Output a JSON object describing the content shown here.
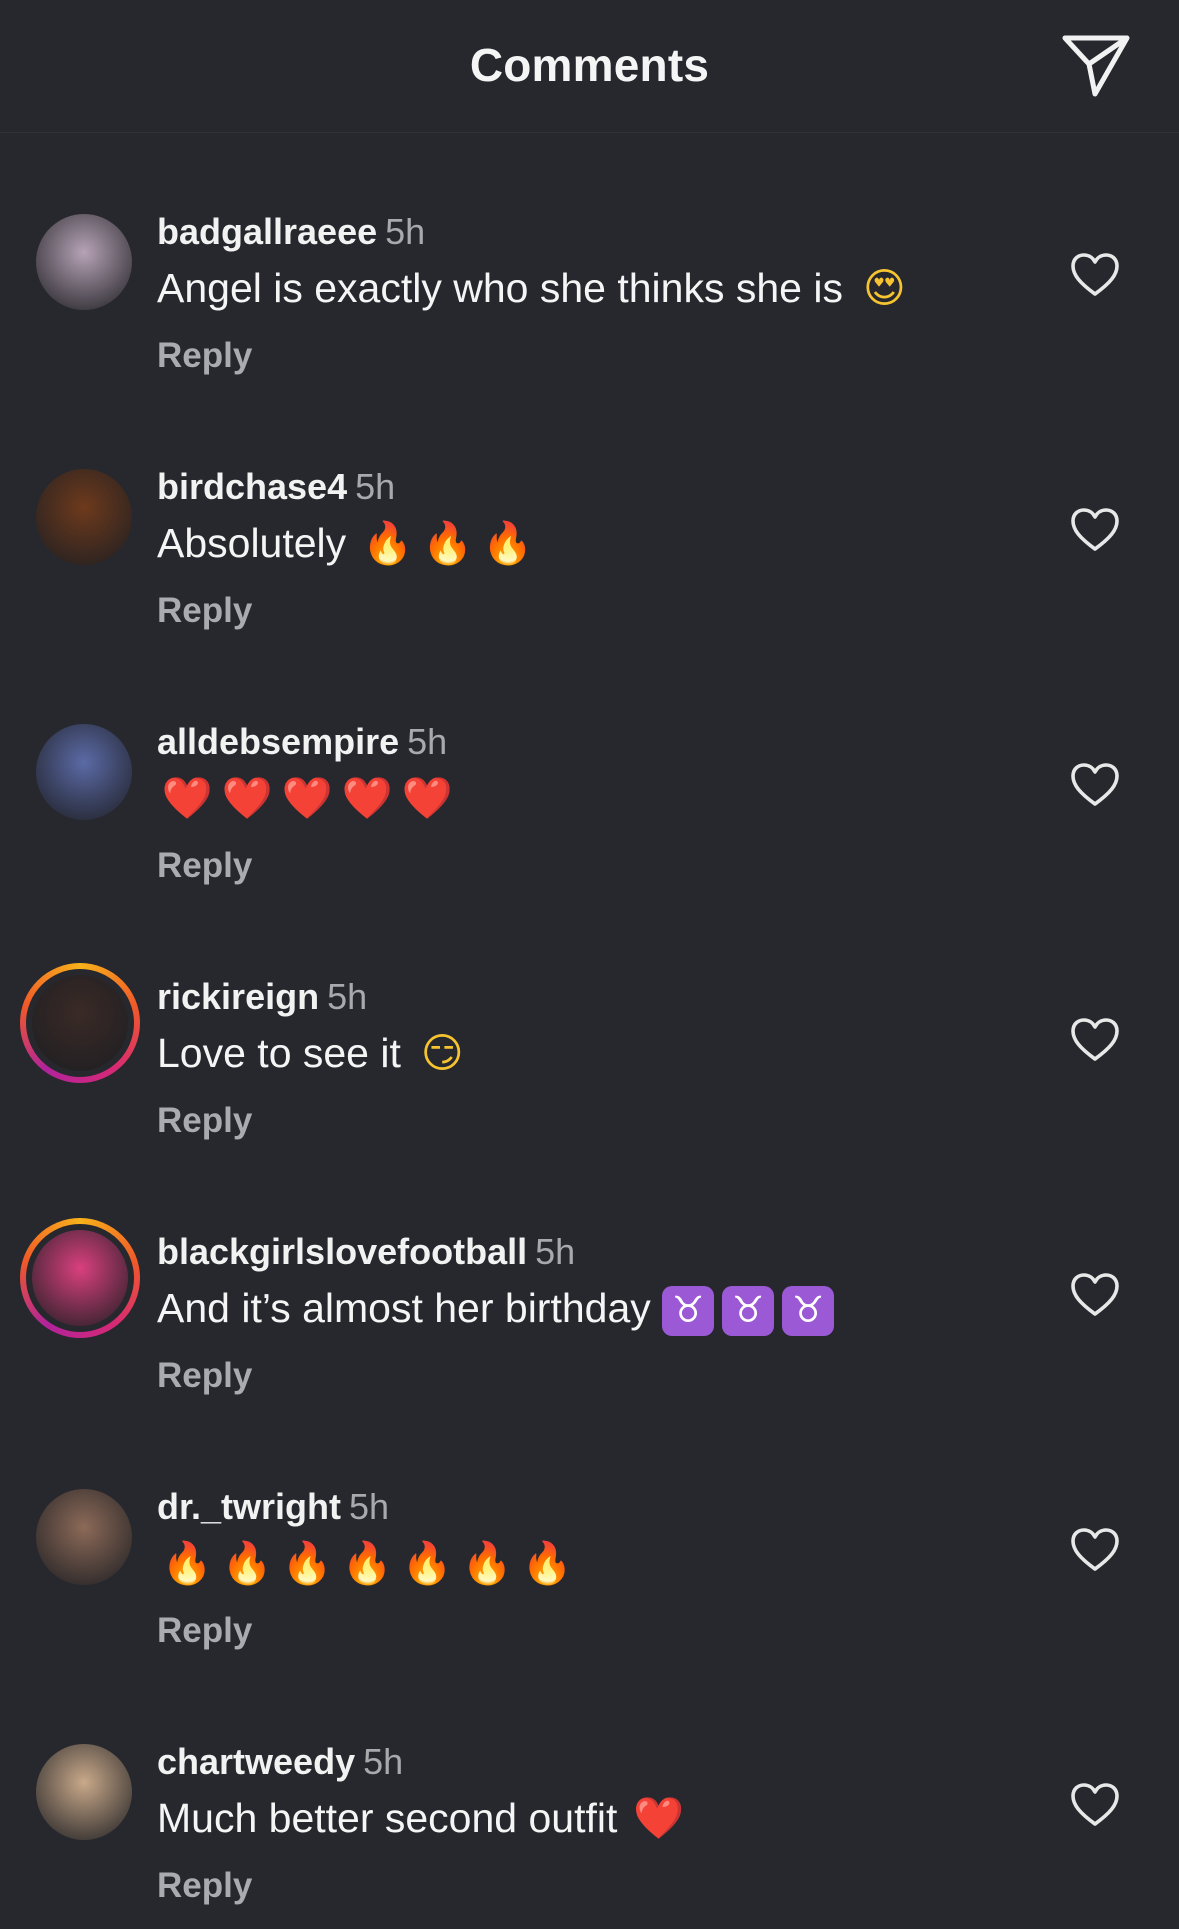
{
  "header": {
    "title": "Comments",
    "send_icon": "paper-plane-icon"
  },
  "comments": [
    {
      "username": "badgallraeee",
      "time": "5h",
      "text": "Angel is exactly who she thinks she is",
      "emojis": [
        "😍"
      ],
      "reply": "Reply",
      "ring": false,
      "avatar_color": "#b6a3b6"
    },
    {
      "username": "birdchase4",
      "time": "5h",
      "text": "Absolutely",
      "emojis": [
        "🔥",
        "🔥",
        "🔥"
      ],
      "reply": "Reply",
      "ring": false,
      "avatar_color": "#6e3a1c"
    },
    {
      "username": "alldebsempire",
      "time": "5h",
      "text": "",
      "emojis": [
        "❤️",
        "❤️",
        "❤️",
        "❤️",
        "❤️"
      ],
      "reply": "Reply",
      "ring": false,
      "avatar_color": "#5b6aa6"
    },
    {
      "username": "rickireign",
      "time": "5h",
      "text": "Love to see it",
      "emojis": [
        "😏"
      ],
      "reply": "Reply",
      "ring": true,
      "avatar_color": "#3a2a26"
    },
    {
      "username": "blackgirlslovefootball",
      "time": "5h",
      "text": "And it’s almost her birthday",
      "emojis": [
        "♉",
        "♉",
        "♉"
      ],
      "reply": "Reply",
      "ring": true,
      "avatar_color": "#d9407e"
    },
    {
      "username": "dr._twright",
      "time": "5h",
      "text": "",
      "emojis": [
        "🔥",
        "🔥",
        "🔥",
        "🔥",
        "🔥",
        "🔥",
        "🔥"
      ],
      "reply": "Reply",
      "ring": false,
      "avatar_color": "#8c6a58"
    },
    {
      "username": "chartweedy",
      "time": "5h",
      "text": "Much better second outfit",
      "emojis": [
        "❤️"
      ],
      "reply": "Reply",
      "ring": false,
      "avatar_color": "#c9a98a"
    }
  ],
  "icons": {
    "like": "heart-outline-icon"
  },
  "colors": {
    "background": "#26282d",
    "secondary_text": "#a8a8ad",
    "heart_red": "#e8202c",
    "fire_orange": "#ff7a1a",
    "taurus_purple": "#9b59d6"
  }
}
